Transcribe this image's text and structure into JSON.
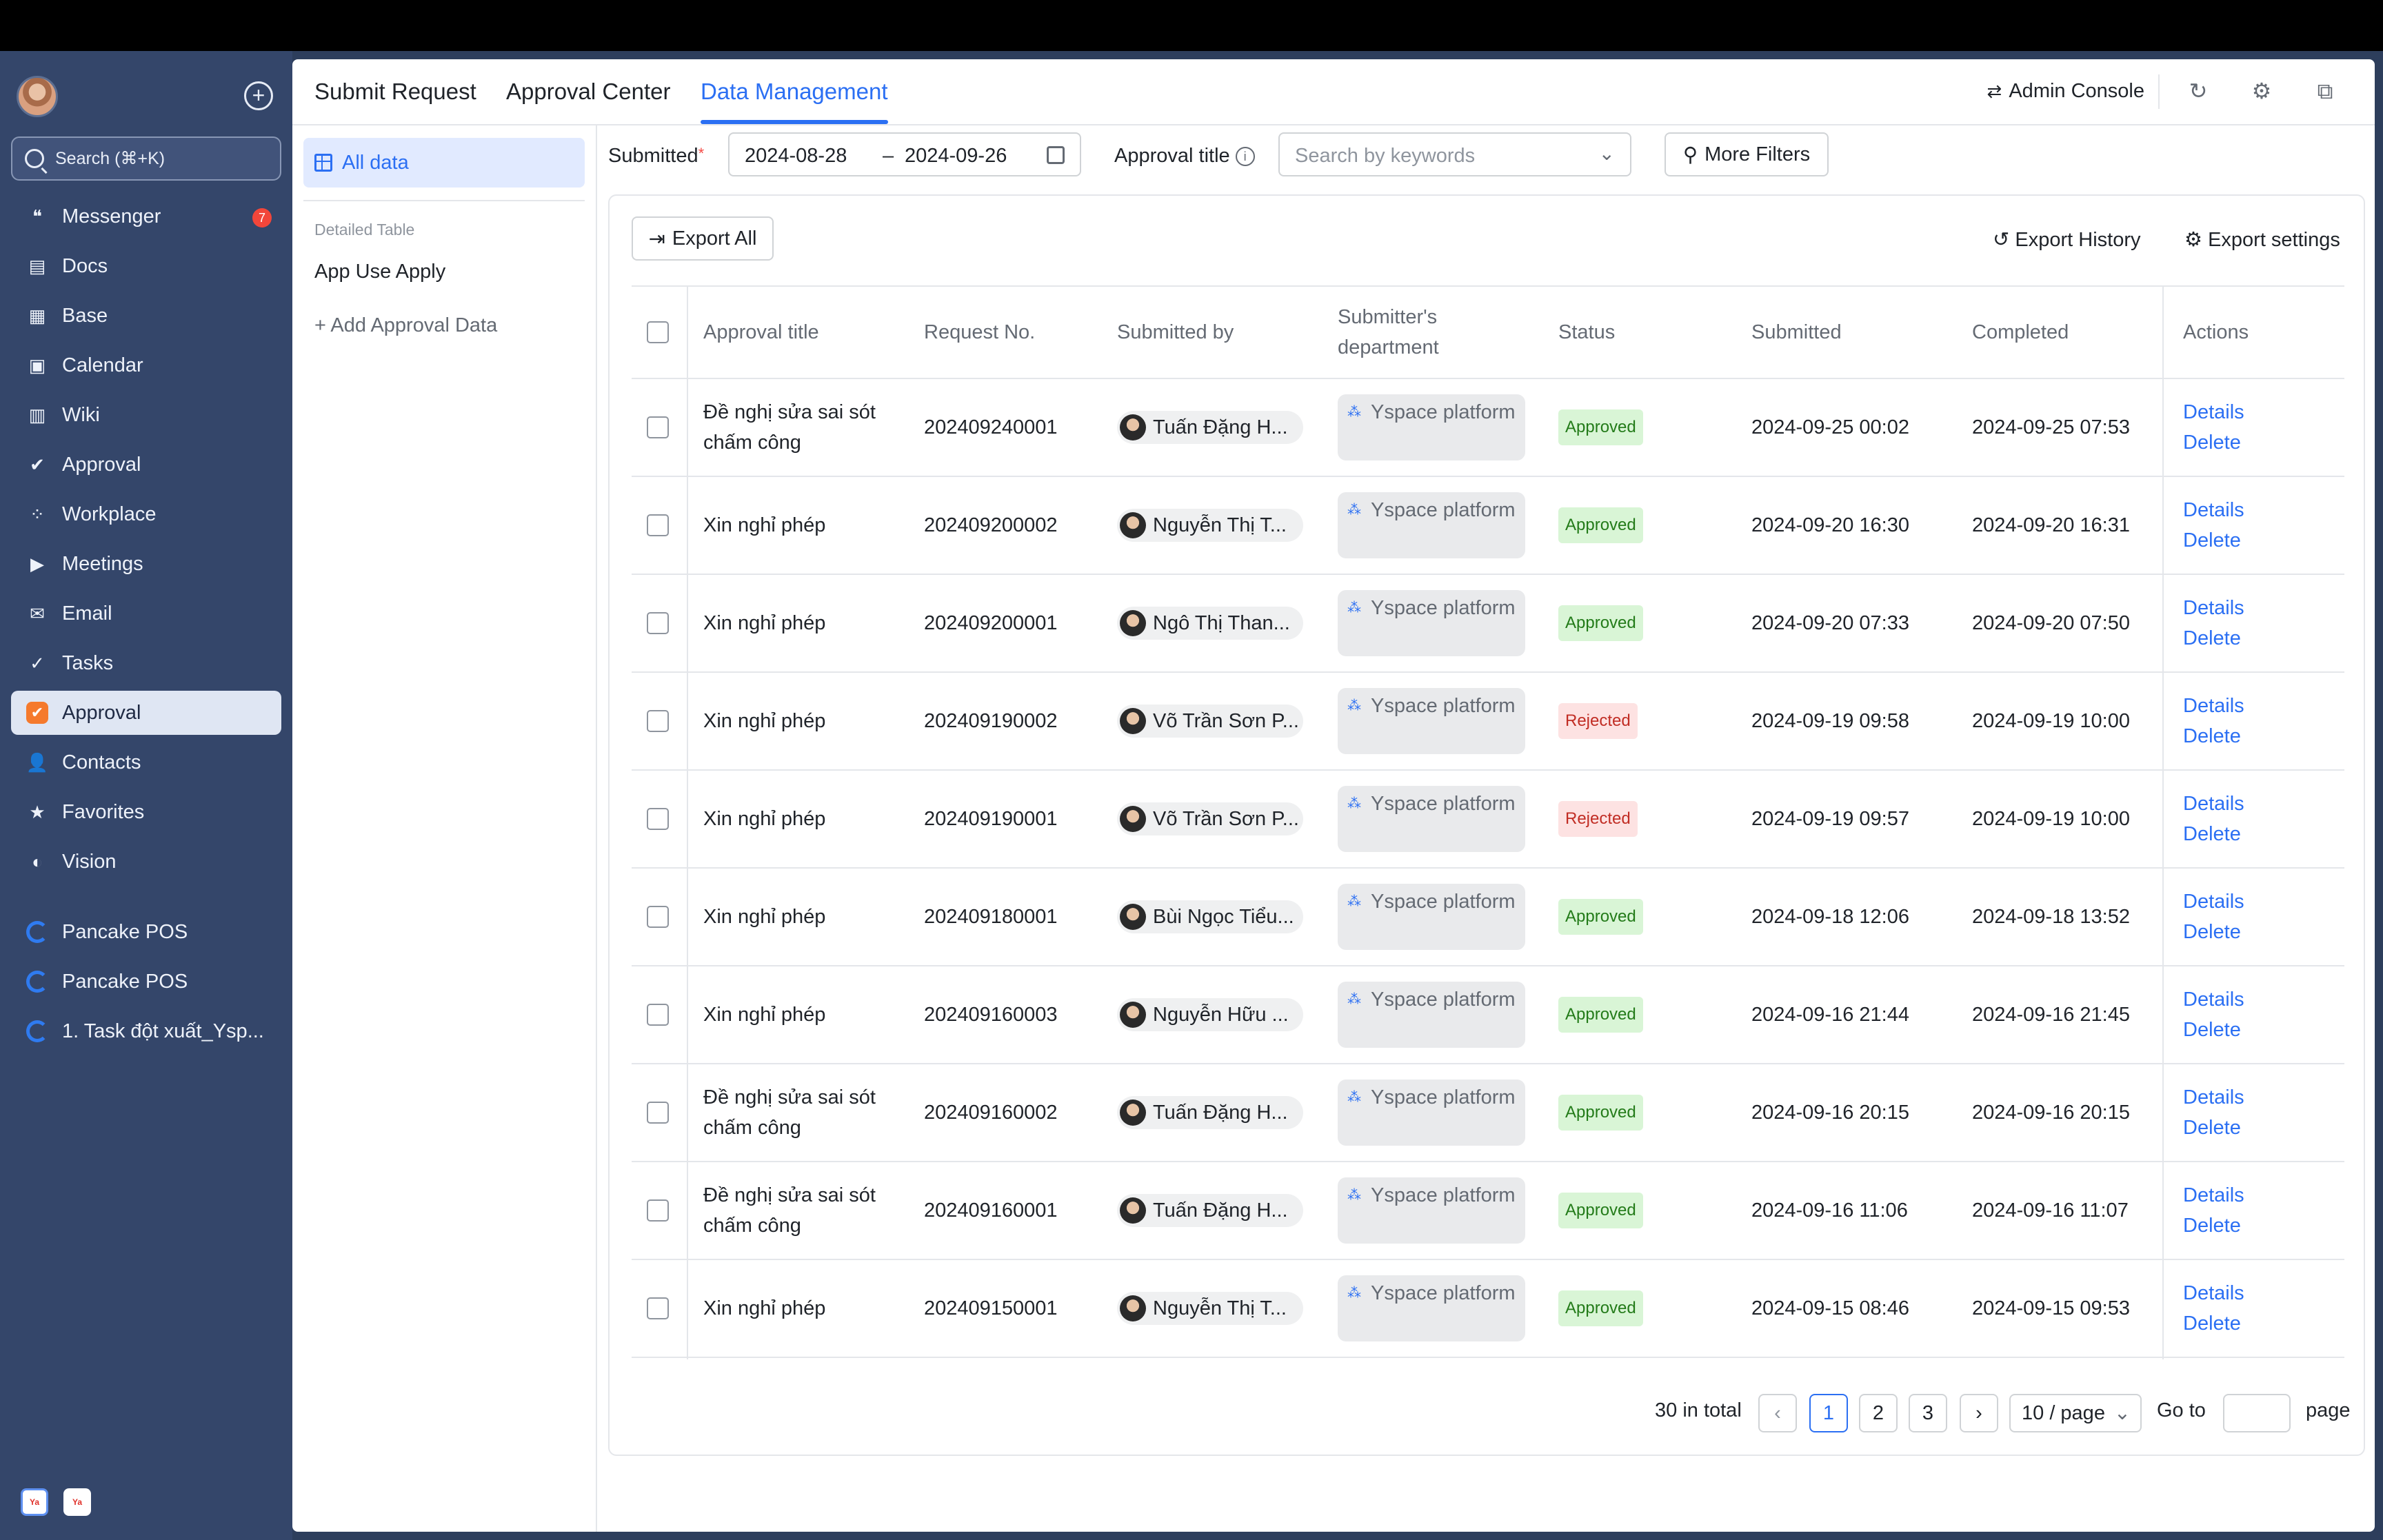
{
  "sidebar": {
    "search_label": "Search (⌘+K)",
    "items": [
      {
        "label": "Messenger",
        "icon": "chat-bubble-icon",
        "glyph": "❝",
        "badge": "7"
      },
      {
        "label": "Docs",
        "icon": "docs-icon",
        "glyph": "▤"
      },
      {
        "label": "Base",
        "icon": "base-table-icon",
        "glyph": "▦"
      },
      {
        "label": "Calendar",
        "icon": "calendar-icon",
        "glyph": "▣"
      },
      {
        "label": "Wiki",
        "icon": "wiki-icon",
        "glyph": "▥"
      },
      {
        "label": "Approval",
        "icon": "approval-check-icon",
        "glyph": "✔"
      },
      {
        "label": "Workplace",
        "icon": "workplace-grid-icon",
        "glyph": "⁘"
      },
      {
        "label": "Meetings",
        "icon": "video-camera-icon",
        "glyph": "▶"
      },
      {
        "label": "Email",
        "icon": "envelope-icon",
        "glyph": "✉"
      },
      {
        "label": "Tasks",
        "icon": "task-check-icon",
        "glyph": "✓"
      },
      {
        "label": "Approval",
        "icon": "approval-app-icon",
        "glyph": "✔",
        "active": true
      },
      {
        "label": "Contacts",
        "icon": "contacts-icon",
        "glyph": "👤"
      },
      {
        "label": "Favorites",
        "icon": "star-icon",
        "glyph": "★"
      },
      {
        "label": "Vision",
        "icon": "vision-icon",
        "glyph": "◐"
      }
    ],
    "pinned": [
      {
        "label": "Pancake POS"
      },
      {
        "label": "Pancake POS"
      },
      {
        "label": "1. Task đột xuất_Ysp..."
      }
    ]
  },
  "tabs": [
    {
      "label": "Submit Request"
    },
    {
      "label": "Approval Center"
    },
    {
      "label": "Data Management",
      "active": true
    }
  ],
  "toolbar": {
    "admin_console": "Admin Console"
  },
  "leftcol": {
    "all_data": "All data",
    "caption": "Detailed Table",
    "item": "App Use Apply",
    "add": "+ Add Approval Data"
  },
  "filters": {
    "submitted_label": "Submitted",
    "date_start": "2024-08-28",
    "date_sep": "–",
    "date_end": "2024-09-26",
    "approval_title_label": "Approval title",
    "keywords_placeholder": "Search by keywords",
    "more_filters": "More Filters"
  },
  "card": {
    "export_all": "Export All",
    "export_history": "Export History",
    "export_settings": "Export settings"
  },
  "table": {
    "headers": {
      "title": "Approval title",
      "req": "Request No.",
      "by": "Submitted by",
      "dept": "Submitter's department",
      "status": "Status",
      "submitted": "Submitted",
      "completed": "Completed",
      "actions": "Actions"
    },
    "action_details": "Details",
    "action_delete": "Delete",
    "rows": [
      {
        "title": "Đề nghị sửa sai sót chấm công",
        "req": "202409240001",
        "by": "Tuấn Đặng H...",
        "dept": "Yspace platform",
        "status": "Approved",
        "submitted": "2024-09-25 00:02",
        "completed": "2024-09-25 07:53"
      },
      {
        "title": "Xin nghỉ phép",
        "req": "202409200002",
        "by": "Nguyễn Thị T...",
        "dept": "Yspace platform",
        "status": "Approved",
        "submitted": "2024-09-20 16:30",
        "completed": "2024-09-20 16:31"
      },
      {
        "title": "Xin nghỉ phép",
        "req": "202409200001",
        "by": "Ngô Thị Than...",
        "dept": "Yspace platform",
        "status": "Approved",
        "submitted": "2024-09-20 07:33",
        "completed": "2024-09-20 07:50"
      },
      {
        "title": "Xin nghỉ phép",
        "req": "202409190002",
        "by": "Võ Trần Sơn P...",
        "dept": "Yspace platform",
        "status": "Rejected",
        "submitted": "2024-09-19 09:58",
        "completed": "2024-09-19 10:00"
      },
      {
        "title": "Xin nghỉ phép",
        "req": "202409190001",
        "by": "Võ Trần Sơn P...",
        "dept": "Yspace platform",
        "status": "Rejected",
        "submitted": "2024-09-19 09:57",
        "completed": "2024-09-19 10:00"
      },
      {
        "title": "Xin nghỉ phép",
        "req": "202409180001",
        "by": "Bùi Ngọc Tiểu...",
        "dept": "Yspace platform",
        "status": "Approved",
        "submitted": "2024-09-18 12:06",
        "completed": "2024-09-18 13:52"
      },
      {
        "title": "Xin nghỉ phép",
        "req": "202409160003",
        "by": "Nguyễn Hữu ...",
        "dept": "Yspace platform",
        "status": "Approved",
        "submitted": "2024-09-16 21:44",
        "completed": "2024-09-16 21:45"
      },
      {
        "title": "Đề nghị sửa sai sót chấm công",
        "req": "202409160002",
        "by": "Tuấn Đặng H...",
        "dept": "Yspace platform",
        "status": "Approved",
        "submitted": "2024-09-16 20:15",
        "completed": "2024-09-16 20:15"
      },
      {
        "title": "Đề nghị sửa sai sót chấm công",
        "req": "202409160001",
        "by": "Tuấn Đặng H...",
        "dept": "Yspace platform",
        "status": "Approved",
        "submitted": "2024-09-16 11:06",
        "completed": "2024-09-16 11:07"
      },
      {
        "title": "Xin nghỉ phép",
        "req": "202409150001",
        "by": "Nguyễn Thị T...",
        "dept": "Yspace platform",
        "status": "Approved",
        "submitted": "2024-09-15 08:46",
        "completed": "2024-09-15 09:53"
      }
    ]
  },
  "pagination": {
    "total": "30 in total",
    "pages": [
      "1",
      "2",
      "3"
    ],
    "current": "1",
    "page_size": "10 / page",
    "goto_label": "Go to",
    "page_suffix": "page"
  },
  "colors": {
    "accent": "#2b6ff3",
    "sidebar": "#34466a",
    "approved": "#237b19",
    "rejected": "#c12d24"
  }
}
